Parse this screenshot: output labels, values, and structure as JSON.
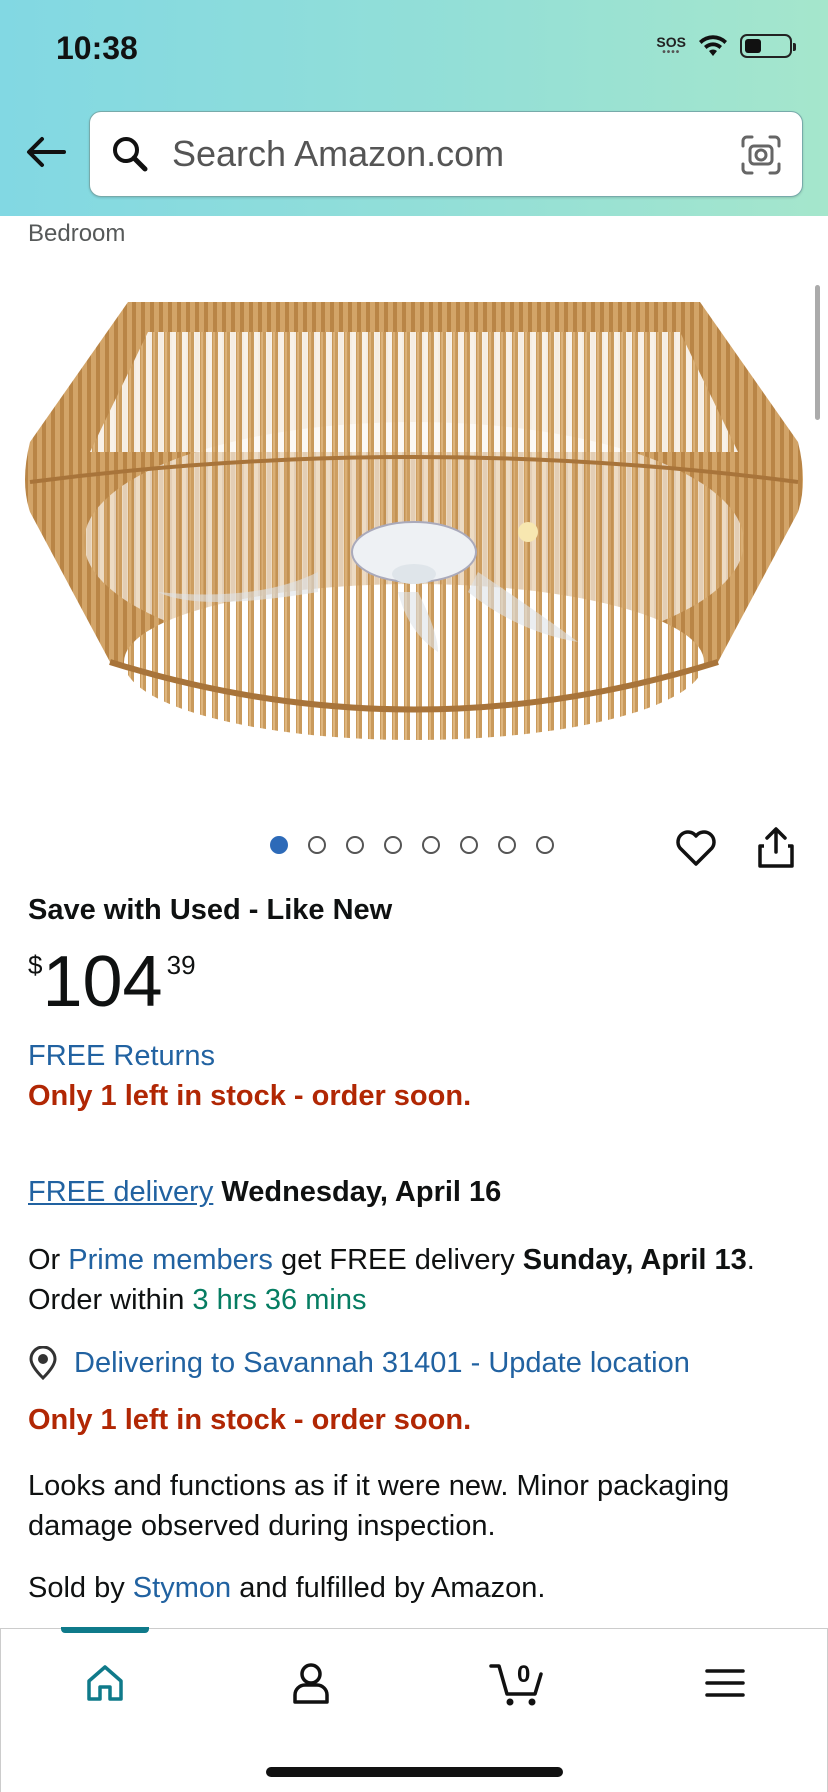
{
  "status_bar": {
    "time": "10:38",
    "sos": "SOS"
  },
  "search": {
    "placeholder": "Search Amazon.com"
  },
  "breadcrumb": "Bedroom",
  "gallery": {
    "image_count": 8,
    "active_index": 0
  },
  "offer": {
    "title": "Save with Used - Like New",
    "price_symbol": "$",
    "price_whole": "104",
    "price_fraction": "39",
    "free_returns": "FREE Returns",
    "stock_notice": "Only 1 left in stock - order soon."
  },
  "delivery": {
    "free_delivery_link": "FREE delivery",
    "date": "Wednesday, April 16",
    "prime_prefix": "Or",
    "prime_link": "Prime members",
    "prime_middle": "get FREE delivery",
    "prime_date": "Sunday, April 13",
    "prime_end": ".",
    "order_within_label": "Order within",
    "order_within_time": "3 hrs 36 mins",
    "location": "Delivering to Savannah 31401 - Update location"
  },
  "condition_note": "Looks and functions as if it were new. Minor packaging damage observed during inspection.",
  "sold_by": {
    "prefix": "Sold by",
    "seller": "Stymon",
    "suffix": "and fulfilled by Amazon."
  },
  "bottom_nav": {
    "items": [
      "home",
      "account",
      "cart",
      "menu"
    ],
    "cart_count": "0",
    "active": "home"
  },
  "colors": {
    "link": "#2162a1",
    "stock": "#b12704",
    "green": "#067d62",
    "accent": "#0f7a8a",
    "dot_active": "#2d6ab8"
  }
}
